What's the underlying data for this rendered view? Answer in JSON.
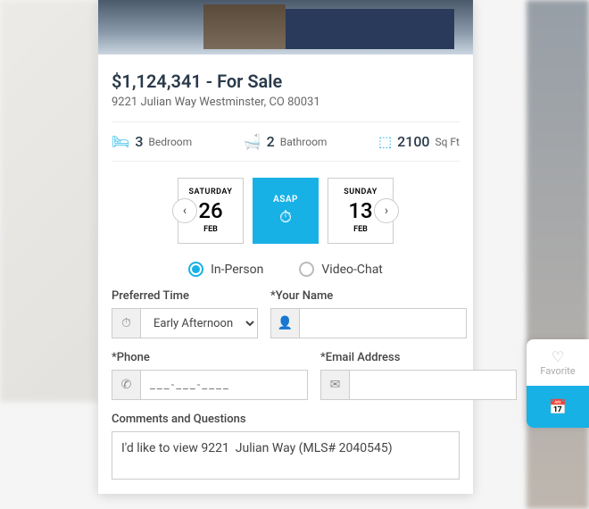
{
  "listing": {
    "price_status": "$1,124,341 - For Sale",
    "address": "9221 Julian Way Westminster, CO 80031",
    "bedrooms_count": "3",
    "bedrooms_label": "Bedroom",
    "bathrooms_count": "2",
    "bathrooms_label": "Bathroom",
    "sqft_count": "2100",
    "sqft_label": "Sq Ft"
  },
  "dates": {
    "slot1": {
      "dow": "SATURDAY",
      "day": "26",
      "mon": "FEB"
    },
    "slot2": {
      "label": "ASAP"
    },
    "slot3": {
      "dow": "SUNDAY",
      "day": "13",
      "mon": "FEB"
    }
  },
  "tour": {
    "in_person": "In-Person",
    "video_chat": "Video-Chat",
    "selected": "in_person"
  },
  "form": {
    "time_label": "Preferred Time",
    "time_value": "Early Afternoon",
    "name_label": "*Your Name",
    "phone_label": "*Phone",
    "phone_placeholder": "___-___-____",
    "email_label": "*Email Address",
    "comments_label": "Comments and Questions",
    "comments_value": "I'd like to view 9221  Julian Way (MLS# 2040545)"
  },
  "sidebar": {
    "favorite": "Favorite"
  },
  "colors": {
    "accent": "#18b1e6"
  }
}
